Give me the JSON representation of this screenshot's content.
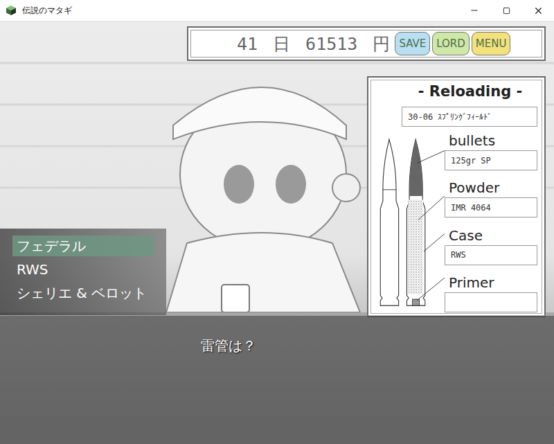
{
  "window": {
    "title": "伝説のマタギ"
  },
  "hud": {
    "day": "41",
    "day_unit": "日",
    "money": "61513",
    "money_unit": "円",
    "buttons": [
      {
        "label": "SAVE",
        "color": "#b9e0f2"
      },
      {
        "label": "LORD",
        "color": "#cfe8a8"
      },
      {
        "label": "MENU",
        "color": "#f3e27c"
      }
    ]
  },
  "reloading": {
    "title": "- Reloading -",
    "cartridge": "30-06 ｽﾌﾟﾘﾝｸﾞﾌｨｰﾙﾄﾞ",
    "components": [
      {
        "label": "bullets",
        "value": "125gr SP"
      },
      {
        "label": "Powder",
        "value": "IMR 4064"
      },
      {
        "label": "Case",
        "value": "RWS"
      },
      {
        "label": "Primer",
        "value": ""
      }
    ]
  },
  "choices": [
    {
      "label": "フェデラル",
      "selected": true
    },
    {
      "label": "RWS",
      "selected": false
    },
    {
      "label": "シェリエ & ベロット",
      "selected": false
    }
  ],
  "message": "雷管は？"
}
